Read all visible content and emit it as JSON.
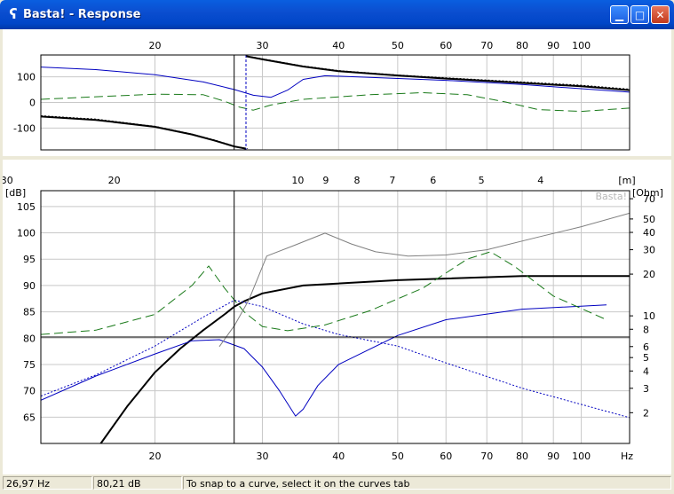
{
  "window": {
    "title": "Basta! - Response",
    "app_icon": "basta-icon",
    "buttons": {
      "minimize": "minimize-icon",
      "maximize": "maximize-icon",
      "close": "close-icon"
    }
  },
  "status_bar": {
    "frequency": "26,97 Hz",
    "level": "80,21 dB",
    "hint": "To snap to a curve, select it on the curves tab"
  },
  "chart_data": [
    {
      "type": "line",
      "name": "phase",
      "x_scale": "log",
      "xlim": [
        13,
        120
      ],
      "ylim": [
        -185,
        185
      ],
      "x_ticks": [
        {
          "v": 20,
          "label": "20"
        },
        {
          "v": 30,
          "label": "30"
        },
        {
          "v": 40,
          "label": "40"
        },
        {
          "v": 50,
          "label": "50"
        },
        {
          "v": 60,
          "label": "60"
        },
        {
          "v": 70,
          "label": "70"
        },
        {
          "v": 80,
          "label": "80"
        },
        {
          "v": 90,
          "label": "90"
        },
        {
          "v": 100,
          "label": "100"
        }
      ],
      "y_ticks": [
        100,
        0,
        -100
      ],
      "grid": true,
      "cursor_x": 26.97,
      "marker_x": 28.2,
      "series": [
        {
          "color": "#000000",
          "style": "solid-thick",
          "segments": [
            {
              "x": [
                13,
                16,
                20,
                23,
                25,
                27,
                28.2
              ],
              "y": [
                -55,
                -68,
                -95,
                -125,
                -148,
                -172,
                -180
              ]
            },
            {
              "x": [
                28.2,
                30,
                35,
                40,
                50,
                60,
                80,
                100,
                120
              ],
              "y": [
                180,
                168,
                140,
                122,
                105,
                93,
                76,
                63,
                48
              ]
            }
          ]
        },
        {
          "color": "#000000",
          "style": "dotted",
          "segments": [
            {
              "x": [
                13,
                16,
                20,
                23,
                25,
                27,
                28.4
              ],
              "y": [
                -52,
                -65,
                -93,
                -123,
                -146,
                -170,
                -180
              ]
            },
            {
              "x": [
                28.4,
                30,
                35,
                40,
                50,
                60,
                80,
                100,
                120
              ],
              "y": [
                180,
                170,
                142,
                124,
                107,
                96,
                80,
                67,
                52
              ]
            }
          ]
        },
        {
          "color": "#0000c0",
          "style": "solid",
          "segments": [
            {
              "x": [
                13,
                16,
                20,
                24,
                27,
                29,
                31,
                33,
                35,
                38,
                45,
                60,
                80,
                120
              ],
              "y": [
                138,
                128,
                108,
                80,
                50,
                28,
                20,
                48,
                90,
                104,
                98,
                86,
                70,
                40
              ]
            }
          ]
        },
        {
          "color": "#1a7a1a",
          "style": "dashed",
          "segments": [
            {
              "x": [
                13,
                16,
                20,
                24,
                26,
                27.5,
                29,
                31,
                35,
                45,
                55,
                65,
                75,
                85,
                100,
                120
              ],
              "y": [
                12,
                22,
                32,
                30,
                5,
                -18,
                -30,
                -10,
                12,
                30,
                38,
                30,
                2,
                -28,
                -35,
                -22
              ]
            }
          ]
        }
      ]
    },
    {
      "type": "line",
      "name": "magnitude",
      "x_scale": "log",
      "xlim": [
        13,
        120
      ],
      "ylim": [
        60,
        108
      ],
      "ylabel": "[dB]",
      "y2label": "[Ohm]",
      "y2_scale": "log",
      "y2lim": [
        1.2,
        80
      ],
      "x_ticks": [
        {
          "v": 20,
          "label": "20"
        },
        {
          "v": 30,
          "label": "30"
        },
        {
          "v": 40,
          "label": "40"
        },
        {
          "v": 50,
          "label": "50"
        },
        {
          "v": 60,
          "label": "60"
        },
        {
          "v": 70,
          "label": "70"
        },
        {
          "v": 80,
          "label": "80"
        },
        {
          "v": 90,
          "label": "90"
        },
        {
          "v": 100,
          "label": "100"
        }
      ],
      "x_unit": "Hz",
      "top_ticks": [
        {
          "v": 30,
          "label": "30"
        },
        {
          "v": 20,
          "label": "20"
        },
        {
          "v": 10,
          "label": "10"
        },
        {
          "v": 9,
          "label": "9"
        },
        {
          "v": 8,
          "label": "8"
        },
        {
          "v": 7,
          "label": "7"
        },
        {
          "v": 6,
          "label": "6"
        },
        {
          "v": 5,
          "label": "5"
        },
        {
          "v": 4,
          "label": "4"
        }
      ],
      "top_unit": "[m]",
      "y_ticks": [
        65,
        70,
        75,
        80,
        85,
        90,
        95,
        100,
        105
      ],
      "y2_ticks": [
        {
          "v": 2,
          "label": "2"
        },
        {
          "v": 3,
          "label": "3"
        },
        {
          "v": 4,
          "label": "4"
        },
        {
          "v": 5,
          "label": "5"
        },
        {
          "v": 6,
          "label": "6"
        },
        {
          "v": 8,
          "label": "8"
        },
        {
          "v": 10,
          "label": "10"
        },
        {
          "v": 20,
          "label": "20"
        },
        {
          "v": 30,
          "label": "30"
        },
        {
          "v": 40,
          "label": "40"
        },
        {
          "v": 50,
          "label": "50"
        },
        {
          "v": 70,
          "label": "70"
        }
      ],
      "grid": true,
      "cursor_x": 26.97,
      "cursor_y": 80.21,
      "watermark": "Basta!",
      "series": [
        {
          "color": "#000000",
          "style": "solid-thick",
          "x": [
            13,
            16.3,
            18,
            20,
            22,
            24,
            26,
            27,
            28,
            30,
            35,
            50,
            80,
            120
          ],
          "y": [
            53,
            60,
            67,
            73.5,
            78,
            81.5,
            84.5,
            86,
            87,
            88.5,
            90,
            91,
            91.8,
            91.8
          ]
        },
        {
          "color": "#0000c0",
          "style": "solid",
          "x": [
            13,
            16,
            20,
            23,
            25.5,
            28,
            30,
            32,
            34,
            35,
            37,
            40,
            50,
            60,
            80,
            110
          ],
          "y": [
            68.2,
            72.8,
            77,
            79.5,
            79.7,
            78,
            74.5,
            70,
            65.2,
            66.5,
            71,
            75,
            80.5,
            83.5,
            85.5,
            86.3
          ]
        },
        {
          "color": "#0000c0",
          "style": "dotted",
          "x": [
            13,
            16,
            20,
            24,
            27,
            30,
            35,
            40,
            50,
            60,
            80,
            120
          ],
          "y": [
            69,
            73,
            78.5,
            84,
            87.2,
            86,
            82.7,
            80.7,
            78.5,
            75.3,
            70.5,
            64.9
          ]
        },
        {
          "color": "#1a7a1a",
          "style": "dashed",
          "x": [
            13,
            16,
            20,
            23,
            24.5,
            26,
            28,
            30,
            33,
            38,
            45,
            55,
            65,
            71,
            78,
            90,
            110
          ],
          "y": [
            80.7,
            81.5,
            84.5,
            90,
            93.7,
            89.5,
            85,
            82.2,
            81.4,
            82.5,
            85.2,
            89.5,
            95,
            96.4,
            93.5,
            88,
            83.5
          ]
        },
        {
          "color": "#808080",
          "style": "solid",
          "axis": "y2",
          "x": [
            25.5,
            27,
            28.5,
            30.5,
            34,
            38,
            42,
            46,
            52,
            60,
            70,
            85,
            100,
            120
          ],
          "y": [
            6,
            8.5,
            13,
            27,
            32.5,
            39.5,
            33,
            29,
            27,
            27.5,
            30,
            37,
            44,
            55
          ]
        }
      ]
    }
  ]
}
